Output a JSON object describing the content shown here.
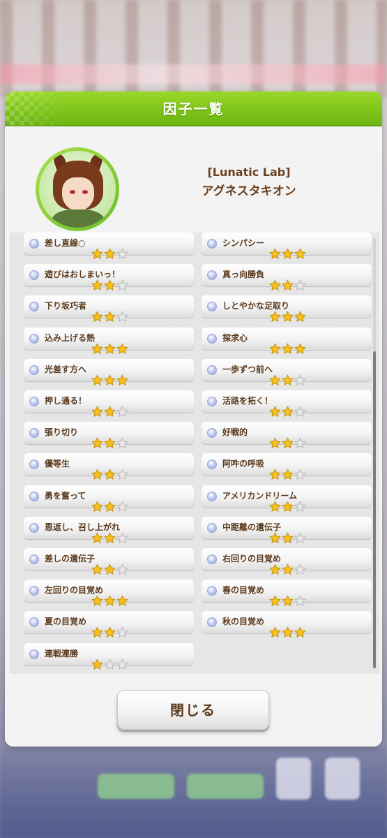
{
  "dialog": {
    "title": "因子一覧",
    "close_label": "閉じる",
    "accent_color": "#7cc419"
  },
  "character": {
    "title": "[Lunatic Lab]",
    "name": "アグネスタキオン"
  },
  "factors_left": [
    {
      "name": "差し直線○",
      "stars": 2
    },
    {
      "name": "遊びはおしまいっ！",
      "stars": 2
    },
    {
      "name": "下り坂巧者",
      "stars": 2
    },
    {
      "name": "込み上げる熱",
      "stars": 3
    },
    {
      "name": "光差す方へ",
      "stars": 3
    },
    {
      "name": "押し通る！",
      "stars": 2
    },
    {
      "name": "張り切り",
      "stars": 2
    },
    {
      "name": "優等生",
      "stars": 2
    },
    {
      "name": "勇を奮って",
      "stars": 2
    },
    {
      "name": "恩返し、召し上がれ",
      "stars": 2
    },
    {
      "name": "差しの遺伝子",
      "stars": 2
    },
    {
      "name": "左回りの目覚め",
      "stars": 3
    },
    {
      "name": "夏の目覚め",
      "stars": 2
    },
    {
      "name": "連戦連勝",
      "stars": 1
    }
  ],
  "factors_right": [
    {
      "name": "シンパシー",
      "stars": 3
    },
    {
      "name": "真っ向勝負",
      "stars": 2
    },
    {
      "name": "しとやかな足取り",
      "stars": 3
    },
    {
      "name": "探求心",
      "stars": 3
    },
    {
      "name": "一歩ずつ前へ",
      "stars": 2
    },
    {
      "name": "活路を拓く！",
      "stars": 2
    },
    {
      "name": "好戦的",
      "stars": 2
    },
    {
      "name": "阿吽の呼吸",
      "stars": 2
    },
    {
      "name": "アメリカンドリーム",
      "stars": 2
    },
    {
      "name": "中距離の遺伝子",
      "stars": 2
    },
    {
      "name": "右回りの目覚め",
      "stars": 2
    },
    {
      "name": "春の目覚め",
      "stars": 2
    },
    {
      "name": "秋の目覚め",
      "stars": 3
    }
  ],
  "star_colors": {
    "filled": "#f7c21b",
    "empty": "#e8e8e8"
  }
}
